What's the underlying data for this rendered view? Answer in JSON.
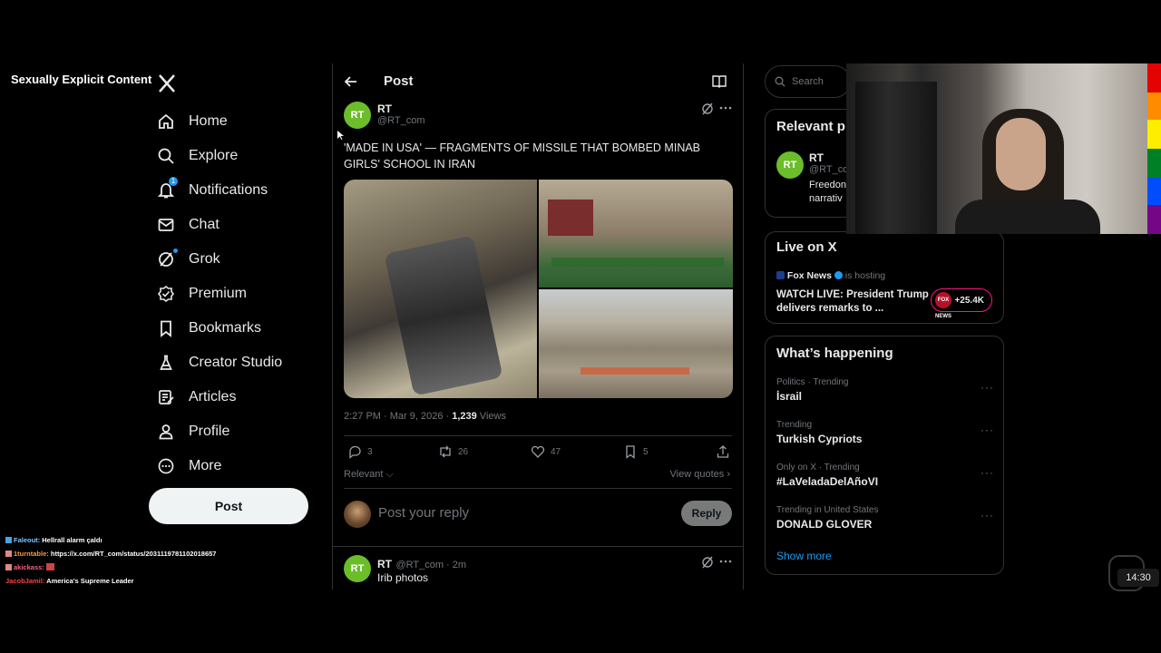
{
  "overlay_label": "Sexually Explicit Content",
  "nav": {
    "items": [
      {
        "label": "Home",
        "icon": "home-icon"
      },
      {
        "label": "Explore",
        "icon": "search-icon"
      },
      {
        "label": "Notifications",
        "icon": "bell-icon",
        "badge": "1"
      },
      {
        "label": "Chat",
        "icon": "mail-icon"
      },
      {
        "label": "Grok",
        "icon": "grok-icon"
      },
      {
        "label": "Premium",
        "icon": "verified-icon"
      },
      {
        "label": "Bookmarks",
        "icon": "bookmark-icon"
      },
      {
        "label": "Creator Studio",
        "icon": "flask-icon"
      },
      {
        "label": "Articles",
        "icon": "article-icon"
      },
      {
        "label": "Profile",
        "icon": "person-icon"
      },
      {
        "label": "More",
        "icon": "more-circle-icon"
      }
    ],
    "post_button": "Post"
  },
  "chat": [
    {
      "user": "Faleout:",
      "msg": "Hellrall alarm çaldı"
    },
    {
      "user": "1turntable:",
      "msg": "https://x.com/RT_com/status/2031119781102018657"
    },
    {
      "user": "akickass:",
      "msg": ""
    },
    {
      "user": "JacobJamil:",
      "msg": "America's Supreme Leader"
    }
  ],
  "post": {
    "header_title": "Post",
    "author_name": "RT",
    "author_handle": "@RT_com",
    "avatar_text": "RT",
    "text": "'MADE IN USA' — FRAGMENTS OF MISSILE THAT BOMBED MINAB GIRLS' SCHOOL IN IRAN",
    "time": "2:27 PM · Mar 9, 2026 · ",
    "views_count": "1,239",
    "views_label": " Views",
    "replies": "3",
    "reposts": "26",
    "likes": "47",
    "bookmarks": "5",
    "sort_label": "Relevant",
    "view_quotes": "View quotes",
    "reply_placeholder": "Post your reply",
    "reply_button": "Reply"
  },
  "reply_tweet": {
    "name": "RT",
    "handle": "@RT_com · 2m",
    "text": "Irib photos"
  },
  "sidebar": {
    "search_placeholder": "Search",
    "relevant_title": "Relevant p",
    "relevant_name": "RT",
    "relevant_handle": "@RT_co",
    "relevant_bio_1": "Freedon",
    "relevant_bio_2": "narrativ",
    "live_title": "Live on X",
    "live_host_name": "Fox News",
    "live_host_suffix": "is hosting",
    "live_text": "WATCH LIVE: President Trump delivers remarks to ...",
    "live_count": "+25.4K",
    "live_badge": "FOX NEWS",
    "whats_title": "What’s happening",
    "trends": [
      {
        "context": "Politics · Trending",
        "name": "İsrail"
      },
      {
        "context": "Trending",
        "name": "Turkish Cypriots"
      },
      {
        "context": "Only on X · Trending",
        "name": "#LaVeladaDelAñoVI"
      },
      {
        "context": "Trending in United States",
        "name": "DONALD GLOVER"
      }
    ],
    "show_more": "Show more"
  },
  "clock": "14:30",
  "colors": {
    "accent": "#1d9bf0",
    "rt_green": "#6bbd2a",
    "live_pink": "#f91880"
  }
}
